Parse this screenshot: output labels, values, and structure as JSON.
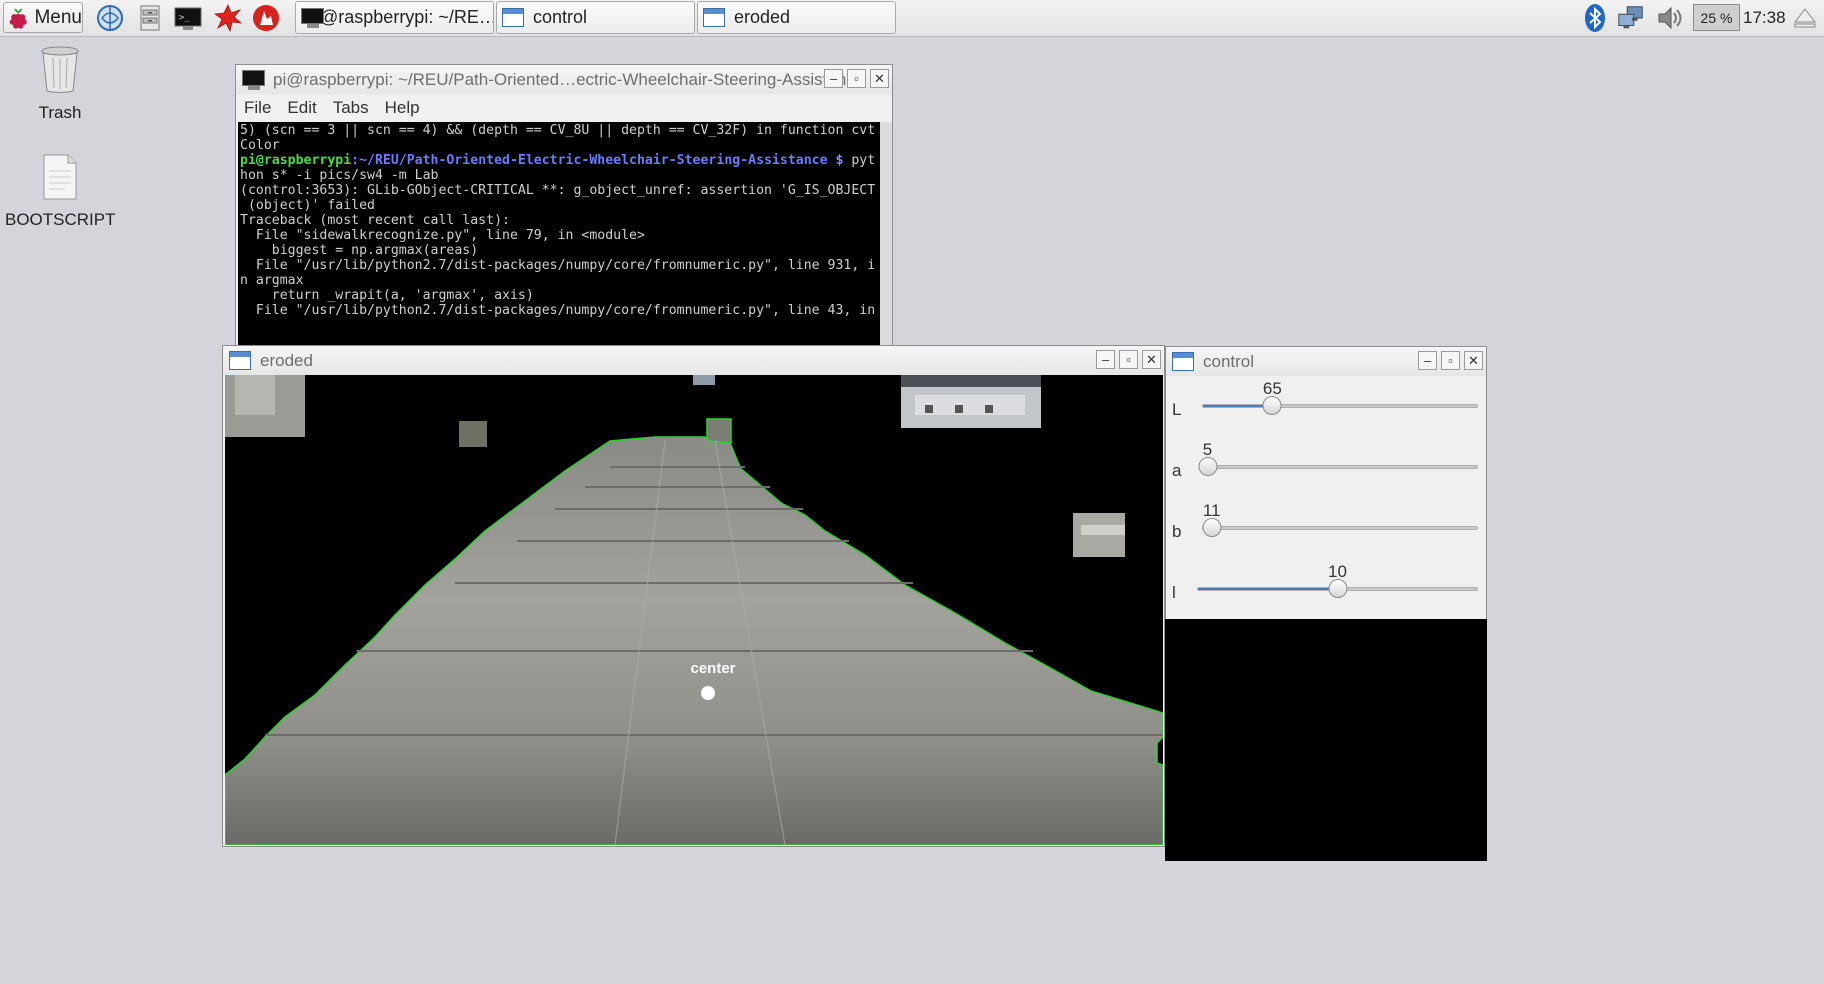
{
  "taskbar": {
    "menu_label": "Menu",
    "launchers": [
      "web-browser-icon",
      "file-manager-icon",
      "terminal-icon",
      "mathematica-icon",
      "wolfram-icon"
    ],
    "tasks": [
      {
        "label": "pi@raspberrypi: ~/RE…",
        "icon": "terminal-icon"
      },
      {
        "label": "control",
        "icon": "window-icon"
      },
      {
        "label": "eroded",
        "icon": "window-icon"
      }
    ],
    "tray": {
      "cpu": "25 %",
      "clock": "17:38"
    }
  },
  "desktop": {
    "icons": [
      {
        "label": "Trash",
        "icon": "trash-icon"
      },
      {
        "label": "BOOTSCRIPT",
        "icon": "document-icon"
      }
    ]
  },
  "terminal": {
    "title": "pi@raspberrypi: ~/REU/Path-Oriented…ectric-Wheelchair-Steering-Assistance",
    "menu": [
      "File",
      "Edit",
      "Tabs",
      "Help"
    ],
    "lines_before": [
      "5) (scn == 3 || scn == 4) && (depth == CV_8U || depth == CV_32F) in function cvt",
      "Color",
      ""
    ],
    "prompt_user": "pi@raspberrypi",
    "prompt_path": ":~/REU/Path-Oriented-Electric-Wheelchair-Steering-Assistance",
    "prompt_dollar": " $",
    "prompt_cmd": " pyt",
    "lines_after": [
      "hon s* -i pics/sw4 -m Lab",
      "",
      "(control:3653): GLib-GObject-CRITICAL **: g_object_unref: assertion 'G_IS_OBJECT",
      " (object)' failed",
      "Traceback (most recent call last):",
      "  File \"sidewalkrecognize.py\", line 79, in <module>",
      "    biggest = np.argmax(areas)",
      "  File \"/usr/lib/python2.7/dist-packages/numpy/core/fromnumeric.py\", line 931, i",
      "n argmax",
      "    return _wrapit(a, 'argmax', axis)",
      "  File \"/usr/lib/python2.7/dist-packages/numpy/core/fromnumeric.py\", line 43, in"
    ]
  },
  "eroded": {
    "title": "eroded",
    "center_label": "center"
  },
  "control": {
    "title": "control",
    "sliders": [
      {
        "name": "L",
        "value": "65",
        "fraction": 0.255
      },
      {
        "name": "a",
        "value": "5",
        "fraction": 0.02
      },
      {
        "name": "b",
        "value": "11",
        "fraction": 0.035
      },
      {
        "name": "l",
        "value": "10",
        "fraction": 0.5
      }
    ]
  },
  "colors": {
    "contour": "#2fd12f",
    "slider_fill": "#4d7bb8",
    "desktop": "#d4d4db"
  }
}
